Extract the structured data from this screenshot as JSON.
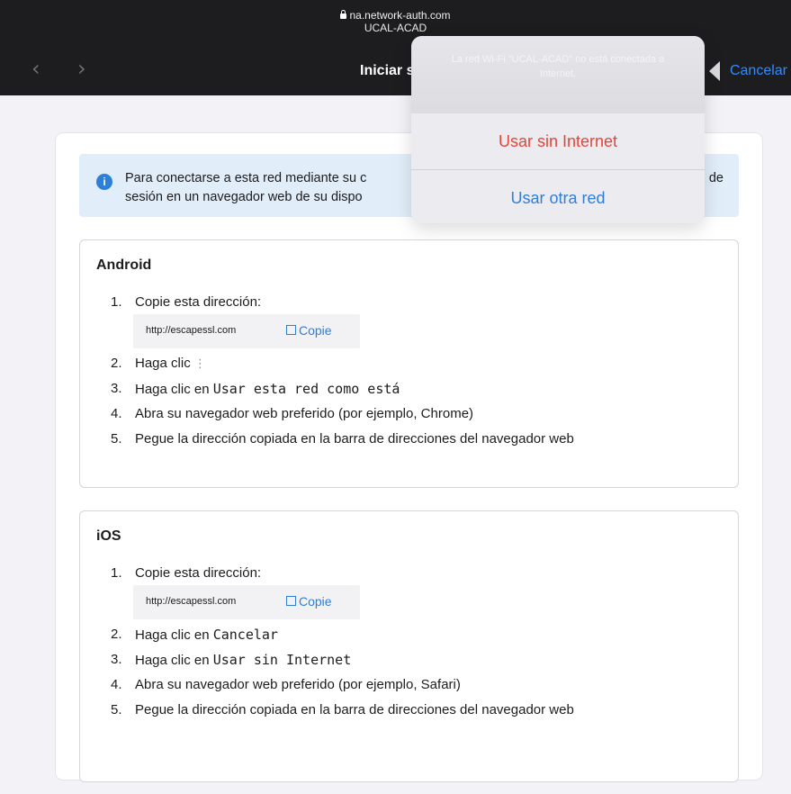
{
  "browser": {
    "url": "na.network-auth.com",
    "ssid": "UCAL-ACAD",
    "title": "Iniciar s",
    "cancel_label": "Cancelar",
    "back_glyph": "‹",
    "forward_glyph": "›"
  },
  "info": {
    "text_line1": "Para conectarse a esta red mediante su c",
    "text_line1_tail": "de",
    "text_line2": "sesión en un navegador web de su dispo",
    "icon_glyph": "i"
  },
  "android": {
    "title": "Android",
    "steps": [
      {
        "num": "1.",
        "text": "Copie esta dirección:"
      },
      {
        "num": "2.",
        "text": "Haga clic",
        "suffix": "⋮"
      },
      {
        "num": "3.",
        "text": "Haga clic en ",
        "code": "Usar esta red como está"
      },
      {
        "num": "4.",
        "text": "Abra su navegador web preferido (por ejemplo, Chrome)"
      },
      {
        "num": "5.",
        "text": "Pegue la dirección copiada en la barra de direcciones del navegador web"
      }
    ],
    "copy": {
      "url": "http://escapessl.com",
      "button": "Copie"
    }
  },
  "ios": {
    "title": "iOS",
    "steps": [
      {
        "num": "1.",
        "text": "Copie esta dirección:"
      },
      {
        "num": "2.",
        "text": "Haga clic en ",
        "code": "Cancelar"
      },
      {
        "num": "3.",
        "text": "Haga clic en ",
        "code": "Usar sin Internet"
      },
      {
        "num": "4.",
        "text": "Abra su navegador web preferido (por ejemplo, Safari)"
      },
      {
        "num": "5.",
        "text": "Pegue la dirección copiada en la barra de direcciones del navegador web"
      }
    ],
    "copy": {
      "url": "http://escapessl.com",
      "button": "Copie"
    }
  },
  "popup": {
    "message": "La red Wi-Fi \"UCAL-ACAD\" no está conectada a Internet.",
    "options": [
      "Usar sin Internet",
      "Usar otra red"
    ]
  },
  "colors": {
    "accent": "#2f7ed8",
    "destructive": "#e0463b",
    "topbar": "#1d1d1f"
  }
}
